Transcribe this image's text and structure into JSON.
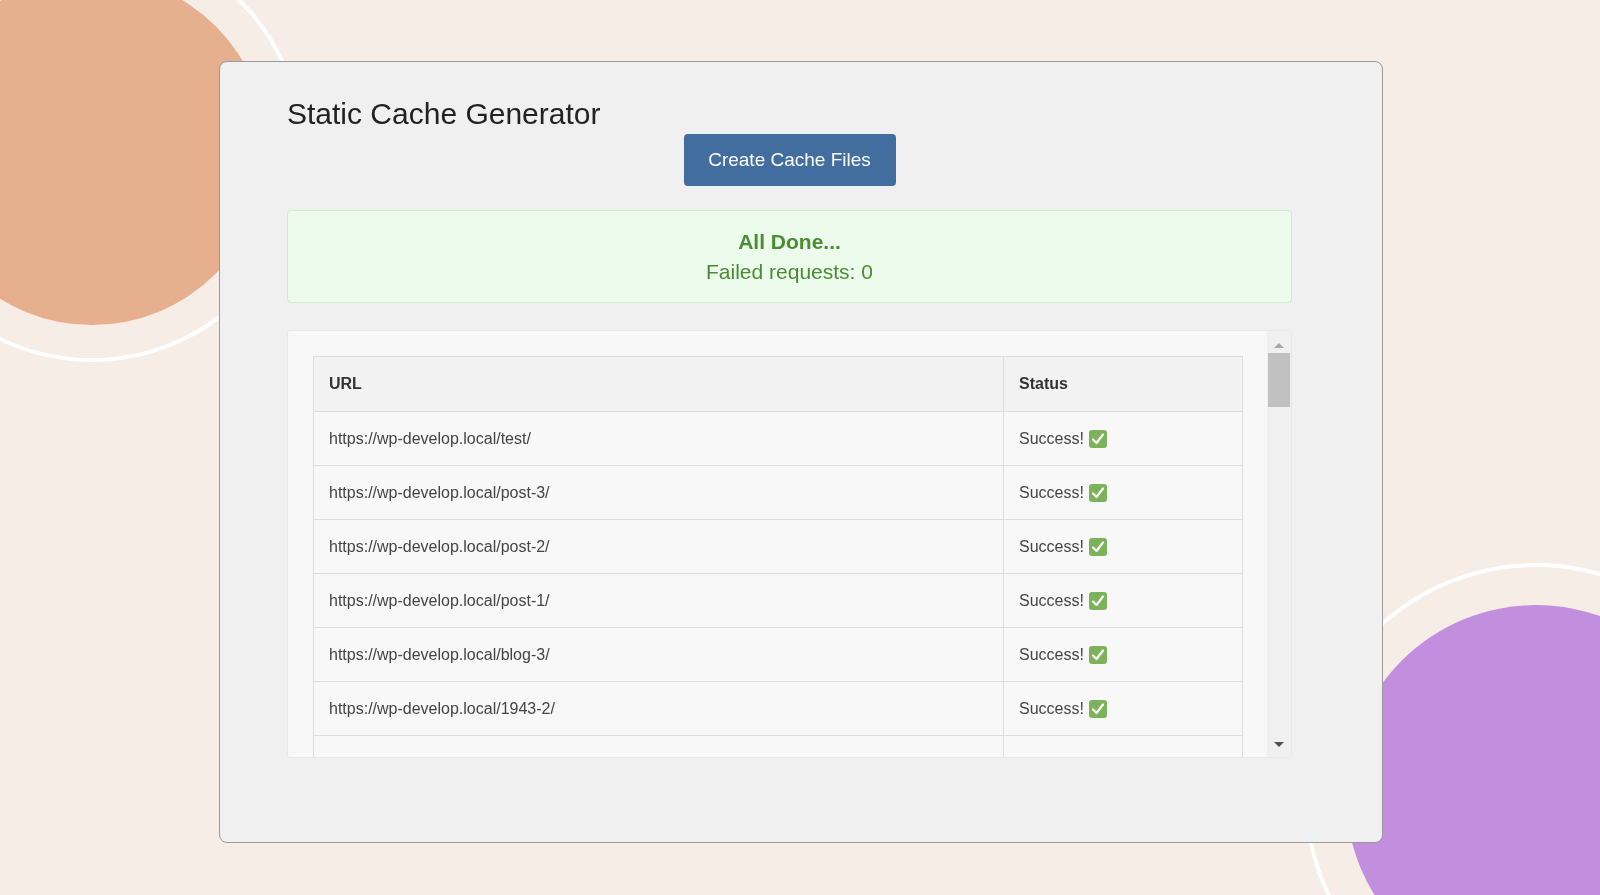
{
  "title": "Static Cache Generator",
  "button": "Create Cache Files",
  "alert": {
    "heading": "All Done...",
    "message": "Failed requests: 0"
  },
  "table": {
    "columns": [
      "URL",
      "Status"
    ],
    "rows": [
      {
        "url": "https://wp-develop.local/test/",
        "status": "Success!",
        "kind": "success"
      },
      {
        "url": "https://wp-develop.local/post-3/",
        "status": "Success!",
        "kind": "success"
      },
      {
        "url": "https://wp-develop.local/post-2/",
        "status": "Success!",
        "kind": "success"
      },
      {
        "url": "https://wp-develop.local/post-1/",
        "status": "Success!",
        "kind": "success"
      },
      {
        "url": "https://wp-develop.local/blog-3/",
        "status": "Success!",
        "kind": "success"
      },
      {
        "url": "https://wp-develop.local/1943-2/",
        "status": "Success!",
        "kind": "success"
      }
    ]
  }
}
